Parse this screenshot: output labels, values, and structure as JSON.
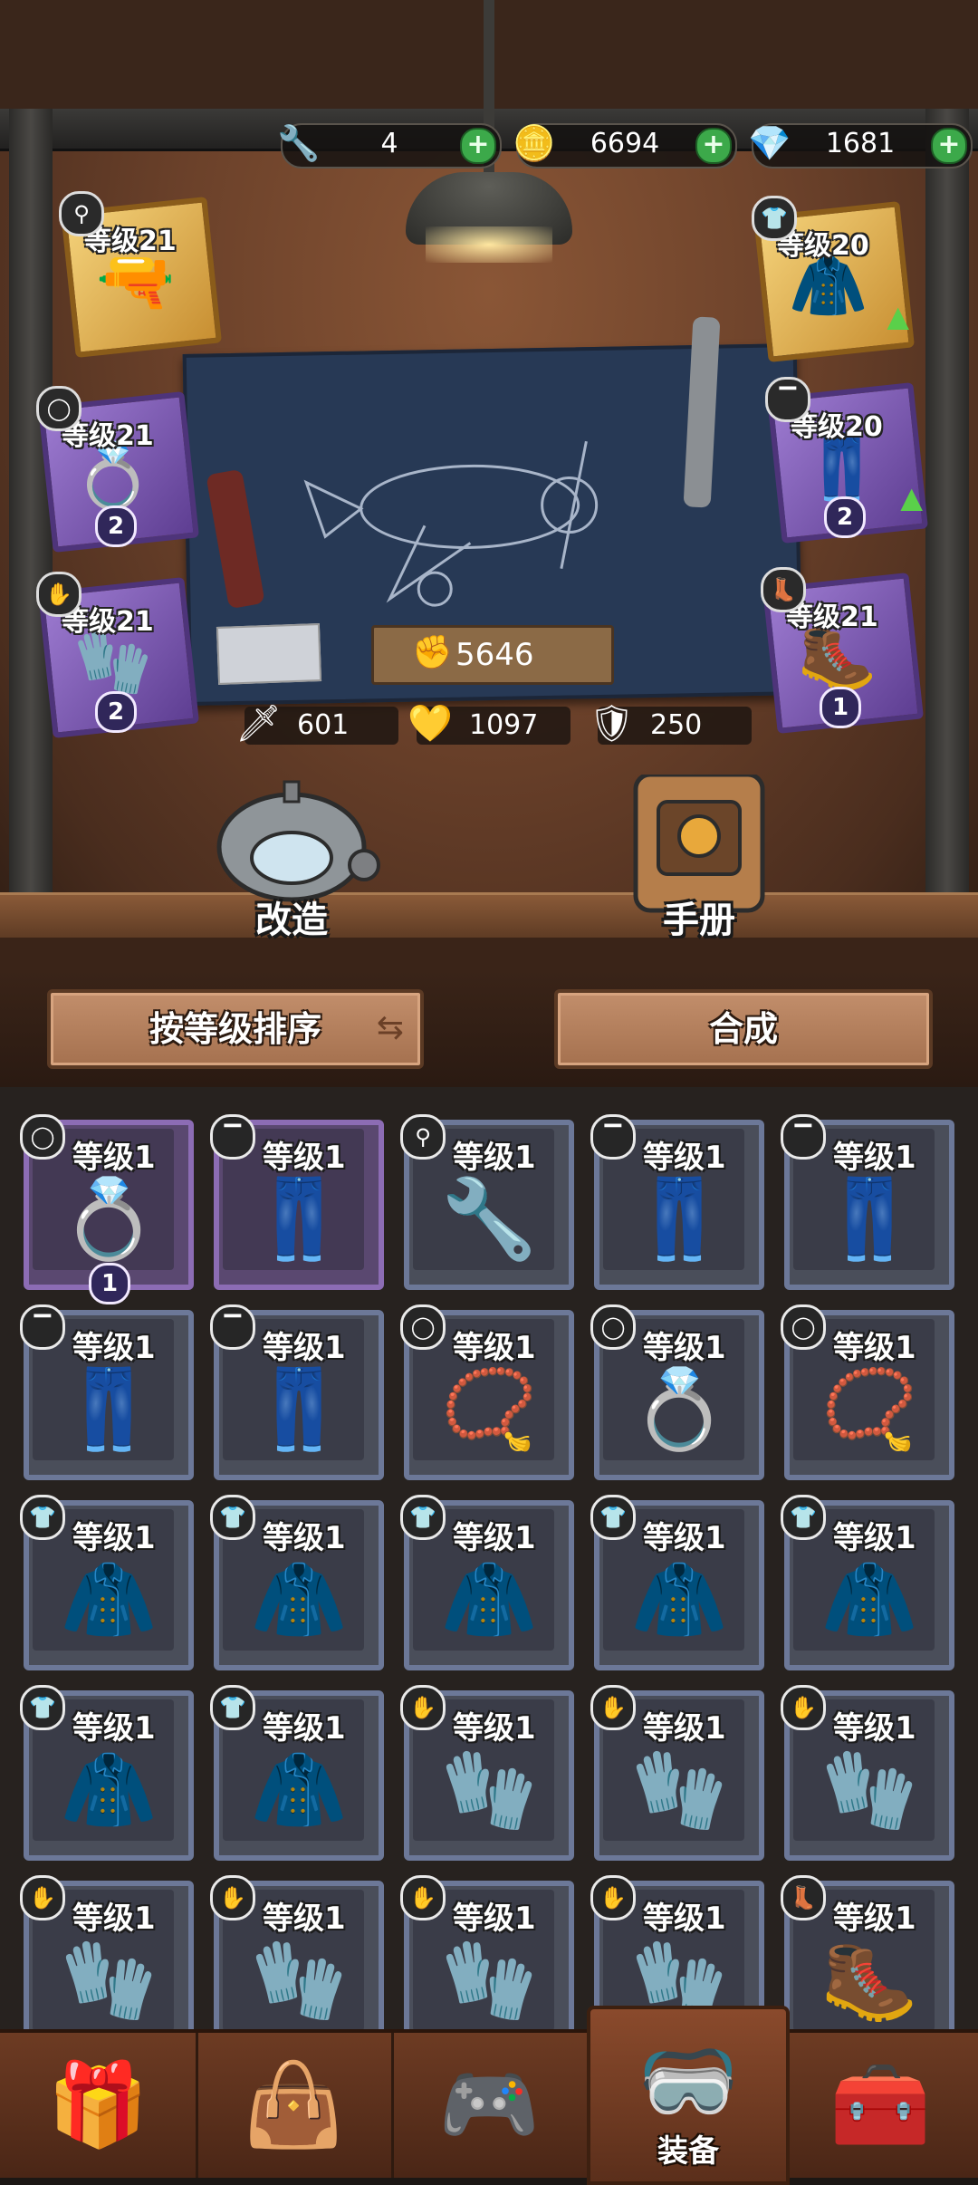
{
  "currencies": [
    {
      "icon": "wrench-icon",
      "glyph": "🔧",
      "value": "4"
    },
    {
      "icon": "coin-icon",
      "glyph": "🪙",
      "value": "6694"
    },
    {
      "icon": "diamond-icon",
      "glyph": "💎",
      "value": "1681"
    }
  ],
  "plus_glyph": "+",
  "power": {
    "icon": "fist-icon",
    "glyph": "✊",
    "value": "5646"
  },
  "stats": [
    {
      "icon": "sword-icon",
      "glyph": "🗡",
      "value": "601"
    },
    {
      "icon": "heart-icon",
      "glyph": "💛",
      "value": "1097"
    },
    {
      "icon": "shield-icon",
      "glyph": "🛡",
      "value": "250"
    }
  ],
  "equipped": {
    "left": [
      {
        "slot": "weapon",
        "type_icon": "key-icon",
        "type_glyph": "⚲",
        "level": "等级21",
        "rarity": "gold",
        "item_glyph": "🔫",
        "count": null,
        "upgrade": false
      },
      {
        "slot": "ring",
        "type_icon": "ring-icon",
        "type_glyph": "◯",
        "level": "等级21",
        "rarity": "purple",
        "item_glyph": "💍",
        "count": "2",
        "upgrade": false
      },
      {
        "slot": "glove",
        "type_icon": "glove-icon",
        "type_glyph": "✋",
        "level": "等级21",
        "rarity": "purple",
        "item_glyph": "🧤",
        "count": "2",
        "upgrade": false
      }
    ],
    "right": [
      {
        "slot": "armor",
        "type_icon": "shirt-icon",
        "type_glyph": "👕",
        "level": "等级20",
        "rarity": "gold",
        "item_glyph": "🧥",
        "count": null,
        "upgrade": true
      },
      {
        "slot": "pants",
        "type_icon": "pants-icon",
        "type_glyph": "▔",
        "level": "等级20",
        "rarity": "purple",
        "item_glyph": "👖",
        "count": "2",
        "upgrade": true
      },
      {
        "slot": "boots",
        "type_icon": "boot-icon",
        "type_glyph": "👢",
        "level": "等级21",
        "rarity": "purple",
        "item_glyph": "🥾",
        "count": "1",
        "upgrade": false
      }
    ]
  },
  "upgrade_glyph": "▲",
  "machines": {
    "modify": "改造",
    "handbook": "手册"
  },
  "controls": {
    "sort": "按等级排序",
    "sort_icon": "swap-icon",
    "sort_glyph": "⇆",
    "craft": "合成"
  },
  "inventory": [
    {
      "level": "等级1",
      "type_icon": "ring-icon",
      "type_glyph": "◯",
      "item_glyph": "💍",
      "rarity": "purple",
      "count": "1"
    },
    {
      "level": "等级1",
      "type_icon": "pants-icon",
      "type_glyph": "▔",
      "item_glyph": "👖",
      "rarity": "purple",
      "count": null
    },
    {
      "level": "等级1",
      "type_icon": "key-icon",
      "type_glyph": "⚲",
      "item_glyph": "🔧",
      "rarity": "blue",
      "count": null
    },
    {
      "level": "等级1",
      "type_icon": "pants-icon",
      "type_glyph": "▔",
      "item_glyph": "👖",
      "rarity": "blue",
      "count": null
    },
    {
      "level": "等级1",
      "type_icon": "pants-icon",
      "type_glyph": "▔",
      "item_glyph": "👖",
      "rarity": "blue",
      "count": null
    },
    {
      "level": "等级1",
      "type_icon": "pants-icon",
      "type_glyph": "▔",
      "item_glyph": "👖",
      "rarity": "blue",
      "count": null
    },
    {
      "level": "等级1",
      "type_icon": "pants-icon",
      "type_glyph": "▔",
      "item_glyph": "👖",
      "rarity": "blue",
      "count": null
    },
    {
      "level": "等级1",
      "type_icon": "ring-icon",
      "type_glyph": "◯",
      "item_glyph": "📿",
      "rarity": "blue",
      "count": null
    },
    {
      "level": "等级1",
      "type_icon": "ring-icon",
      "type_glyph": "◯",
      "item_glyph": "💍",
      "rarity": "blue",
      "count": null
    },
    {
      "level": "等级1",
      "type_icon": "ring-icon",
      "type_glyph": "◯",
      "item_glyph": "📿",
      "rarity": "blue",
      "count": null
    },
    {
      "level": "等级1",
      "type_icon": "shirt-icon",
      "type_glyph": "👕",
      "item_glyph": "🧥",
      "rarity": "blue",
      "count": null
    },
    {
      "level": "等级1",
      "type_icon": "shirt-icon",
      "type_glyph": "👕",
      "item_glyph": "🧥",
      "rarity": "blue",
      "count": null
    },
    {
      "level": "等级1",
      "type_icon": "shirt-icon",
      "type_glyph": "👕",
      "item_glyph": "🧥",
      "rarity": "blue",
      "count": null
    },
    {
      "level": "等级1",
      "type_icon": "shirt-icon",
      "type_glyph": "👕",
      "item_glyph": "🧥",
      "rarity": "blue",
      "count": null
    },
    {
      "level": "等级1",
      "type_icon": "shirt-icon",
      "type_glyph": "👕",
      "item_glyph": "🧥",
      "rarity": "blue",
      "count": null
    },
    {
      "level": "等级1",
      "type_icon": "shirt-icon",
      "type_glyph": "👕",
      "item_glyph": "🧥",
      "rarity": "blue",
      "count": null
    },
    {
      "level": "等级1",
      "type_icon": "shirt-icon",
      "type_glyph": "👕",
      "item_glyph": "🧥",
      "rarity": "blue",
      "count": null
    },
    {
      "level": "等级1",
      "type_icon": "glove-icon",
      "type_glyph": "✋",
      "item_glyph": "🧤",
      "rarity": "blue",
      "count": null
    },
    {
      "level": "等级1",
      "type_icon": "glove-icon",
      "type_glyph": "✋",
      "item_glyph": "🧤",
      "rarity": "blue",
      "count": null
    },
    {
      "level": "等级1",
      "type_icon": "glove-icon",
      "type_glyph": "✋",
      "item_glyph": "🧤",
      "rarity": "blue",
      "count": null
    },
    {
      "level": "等级1",
      "type_icon": "glove-icon",
      "type_glyph": "✋",
      "item_glyph": "🧤",
      "rarity": "blue",
      "count": null
    },
    {
      "level": "等级1",
      "type_icon": "glove-icon",
      "type_glyph": "✋",
      "item_glyph": "🧤",
      "rarity": "blue",
      "count": null
    },
    {
      "level": "等级1",
      "type_icon": "glove-icon",
      "type_glyph": "✋",
      "item_glyph": "🧤",
      "rarity": "blue",
      "count": null
    },
    {
      "level": "等级1",
      "type_icon": "glove-icon",
      "type_glyph": "✋",
      "item_glyph": "🧤",
      "rarity": "blue",
      "count": null
    },
    {
      "level": "等级1",
      "type_icon": "boot-icon",
      "type_glyph": "👢",
      "item_glyph": "🥾",
      "rarity": "blue",
      "count": null
    }
  ],
  "bottom_nav": [
    {
      "name": "nav-treasure-chest",
      "glyph": "🎁",
      "label": ""
    },
    {
      "name": "nav-bag",
      "glyph": "👜",
      "label": ""
    },
    {
      "name": "nav-controller",
      "glyph": "🎮",
      "label": ""
    },
    {
      "name": "nav-equipment",
      "glyph": "🥽",
      "label": "装备",
      "active": true
    },
    {
      "name": "nav-shop",
      "glyph": "🧰",
      "label": ""
    }
  ],
  "colors": {
    "purple_frame": "#8c6cb4",
    "blue_frame": "#6c7898",
    "gold_frame": "#f4d27a",
    "plus_green": "#3ca94a"
  }
}
